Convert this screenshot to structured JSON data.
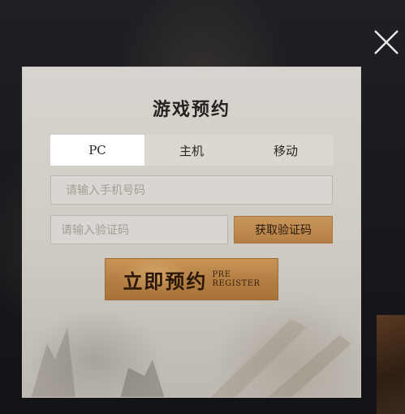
{
  "modal": {
    "title": "游戏预约",
    "tabs": [
      {
        "label": "PC",
        "active": true
      },
      {
        "label": "主机",
        "active": false
      },
      {
        "label": "移动",
        "active": false
      }
    ],
    "phone_placeholder": "请输入手机号码",
    "code_placeholder": "请输入验证码",
    "get_code_label": "获取验证码",
    "register_label": "立即预约",
    "register_sub_line1": "PRE",
    "register_sub_line2": "REGISTER"
  },
  "icons": {
    "close": "close-icon"
  },
  "colors": {
    "accent_gold": "#c08a4e",
    "tab_active_bg": "#ffffff",
    "modal_bg": "#d3d0ca"
  }
}
